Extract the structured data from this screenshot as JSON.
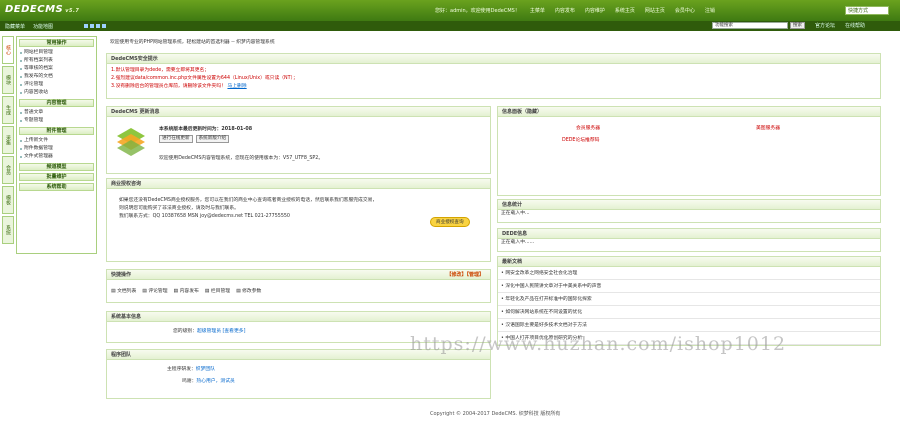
{
  "app": {
    "logo": "DEDECMS",
    "version": "v5.7"
  },
  "topnav": [
    "您好：admin，欢迎使用DedeCMS！",
    "主菜单",
    "内容发布",
    "内容维护",
    "系统主页",
    "网站主页",
    "会员中心",
    "注销"
  ],
  "skin": "快捷方式",
  "subbar": {
    "links": [
      "隐藏菜单",
      "功能地图"
    ]
  },
  "search": {
    "value": "功能搜索",
    "button": "搜索",
    "links": [
      "官方论坛",
      "在线帮助"
    ]
  },
  "vtabs": [
    "核心",
    "模块",
    "生成",
    "采集",
    "会员",
    "模板",
    "系统"
  ],
  "sidebar": {
    "groups": [
      {
        "title": "常用操作",
        "items": [
          "网站栏目管理",
          "所有档案列表",
          "等审核的档案",
          "我发布的文档",
          "评论管理",
          "内容回收站"
        ]
      },
      {
        "title": "内容管理",
        "items": [
          "普通文章",
          "专题管理"
        ]
      },
      {
        "title": "附件管理",
        "items": [
          "上传新文件",
          "附件数据管理",
          "文件式管理器"
        ]
      },
      {
        "title": "频道模型"
      },
      {
        "title": "批量维护"
      },
      {
        "title": "系统帮助"
      }
    ]
  },
  "welcome": "欢迎使用专业的PHP网站管理系统，轻松建站的首选利器 -- 织梦内容管理系统",
  "security": {
    "title": "DedeCMS安全提示",
    "lines": [
      "1.默认管理目录为dede，需要立即将其更名；",
      "2.强烈建议data/common.inc.php文件属性设置为644（Linux/Unix）或只读（NT）；",
      "3.没有删除后台的管理员仓库前，请删除该文件夹吗！"
    ],
    "link": "马上删除"
  },
  "update": {
    "title": "DedeCMS 更新消息",
    "date_line": "本系统版本最后更新时间为：2018-01-08",
    "buttons": [
      "进行在线更新",
      "系统新版介绍"
    ],
    "info": "欢迎使用DedeCMS内容管理系统，您现在的使用版本为：V57_UTF8_SP2。"
  },
  "shortcut_top": {
    "title": "信息面板（隐藏）",
    "links": [
      "会员服务器",
      "美图服务器",
      "DEDE论坛推荐码"
    ]
  },
  "commercial": {
    "title": "商业授权咨询",
    "text1": "如果您还没有DedeCMS商业授权服务，您可以在我们的商业中心查询或者商业授权的电话，然后联系我们客服完成交易，",
    "text2": "则说明您可能购买了非法商业授权，请及时与我们联系。",
    "contact": "我们联系方式：QQ 10387658 MSN joy@dedecms.net TEL 021-27755550",
    "button": "商业授权查询"
  },
  "info_stats": {
    "title": "信息统计",
    "loading": "正在载入中..."
  },
  "dede_info": {
    "title": "DEDE信息",
    "loading": "正在载入中......"
  },
  "quick": {
    "title": "快捷操作",
    "controls": "【修改】【管理】",
    "items": [
      "文档列表",
      "评论管理",
      "内容发布",
      "栏目管理",
      "修改参数"
    ]
  },
  "sysinfo": {
    "title": "系统基本信息",
    "label": "您的级别：",
    "value": "超级管理员 [查看更多]"
  },
  "news": {
    "title": "最新文档",
    "items": [
      "网安全改革之网络安全社会化治理",
      "深化中国人民院讲文章对于中美关系中的声音",
      "年轻化及产品在打开标准中的国际化探索",
      "如何解决网站系统在不同设置的优化",
      "汉语国际主要是好多技术文档对于方法",
      "中国人打开项目优化原创研究的分析"
    ]
  },
  "team": {
    "title": "程序团队",
    "rows": [
      {
        "label": "主程序研发：",
        "value": "织梦团队"
      },
      {
        "label": "鸣谢：",
        "value": "热心用户，测试员"
      }
    ]
  },
  "watermark": "https://www.huzhan.com/ishop1012",
  "footer": "Copyright © 2004-2017 DedeCMS. 织梦科技 版权所有"
}
